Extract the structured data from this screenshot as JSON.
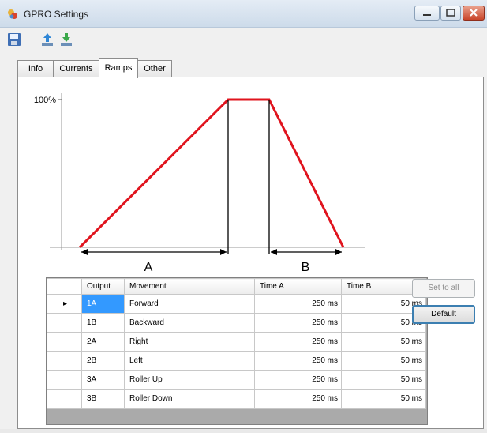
{
  "window": {
    "title": "GPRO Settings",
    "icons": {
      "app": "app-icon",
      "minimize": "minimize-icon",
      "maximize": "maximize-icon",
      "close": "close-icon"
    }
  },
  "toolbar": {
    "buttons": [
      {
        "icon": "save-icon"
      },
      {
        "icon": "upload-icon"
      },
      {
        "icon": "download-icon"
      }
    ]
  },
  "tabs": [
    {
      "label": "Info",
      "active": false
    },
    {
      "label": "Currents",
      "active": false
    },
    {
      "label": "Ramps",
      "active": true
    },
    {
      "label": "Other",
      "active": false
    }
  ],
  "ramp_diagram": {
    "y_max_label": "100%",
    "segment_a_label": "A",
    "segment_b_label": "B",
    "colors": {
      "ramp": "#e0141e",
      "lines": "#000000",
      "axis": "#9a9a9a"
    }
  },
  "grid": {
    "columns": [
      "Output",
      "Movement",
      "Time A",
      "Time B"
    ],
    "current_row_marker": "▸",
    "rows": [
      {
        "output": "1A",
        "movement": "Forward",
        "time_a": "250 ms",
        "time_b": "50 ms"
      },
      {
        "output": "1B",
        "movement": "Backward",
        "time_a": "250 ms",
        "time_b": "50 ms"
      },
      {
        "output": "2A",
        "movement": "Right",
        "time_a": "250 ms",
        "time_b": "50 ms"
      },
      {
        "output": "2B",
        "movement": "Left",
        "time_a": "250 ms",
        "time_b": "50 ms"
      },
      {
        "output": "3A",
        "movement": "Roller Up",
        "time_a": "250 ms",
        "time_b": "50 ms"
      },
      {
        "output": "3B",
        "movement": "Roller Down",
        "time_a": "250 ms",
        "time_b": "50 ms"
      }
    ],
    "selected_row": 0
  },
  "buttons": {
    "set_to_all": "Set to all",
    "default": "Default"
  }
}
